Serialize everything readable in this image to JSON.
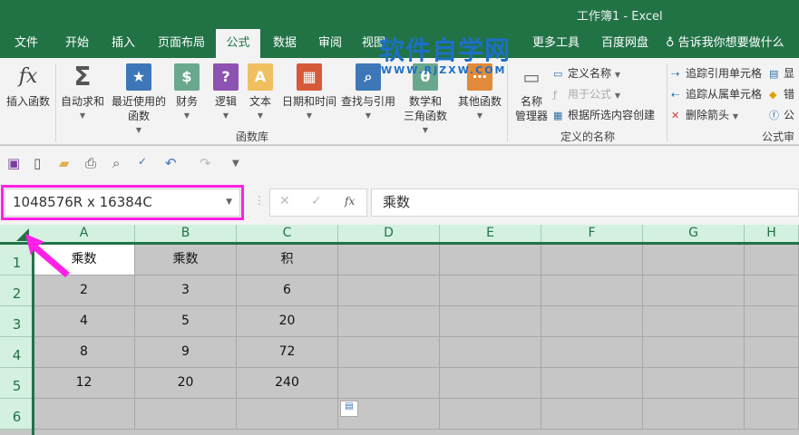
{
  "title": "工作簿1  -  Excel",
  "tabs": [
    "文件",
    "开始",
    "插入",
    "页面布局",
    "公式",
    "数据",
    "审阅",
    "视图",
    "更多工具",
    "百度网盘"
  ],
  "active_tab": "公式",
  "tell_me": "告诉我你想要做什么",
  "watermark": {
    "main": "软件自学网",
    "sub": "WWW.RJZXW.COM"
  },
  "ribbon": {
    "insert_function": "插入函数",
    "library": [
      {
        "line1": "自动求和",
        "line2": "",
        "icon": "sigma-icon",
        "glyph": "Σ",
        "color": "#555555"
      },
      {
        "line1": "最近使用的",
        "line2": "函数",
        "icon": "star-book-icon",
        "glyph": "★",
        "color": "#3d77b8"
      },
      {
        "line1": "财务",
        "line2": "",
        "icon": "coins-book-icon",
        "glyph": "$",
        "color": "#6aa88e"
      },
      {
        "line1": "逻辑",
        "line2": "",
        "icon": "question-book-icon",
        "glyph": "?",
        "color": "#8e52b2"
      },
      {
        "line1": "文本",
        "line2": "",
        "icon": "text-book-icon",
        "glyph": "A",
        "color": "#f0c060"
      },
      {
        "line1": "日期和时间",
        "line2": "",
        "icon": "calendar-book-icon",
        "glyph": "▦",
        "color": "#d65a3a"
      },
      {
        "line1": "查找与引用",
        "line2": "",
        "icon": "search-book-icon",
        "glyph": "⌕",
        "color": "#3d77b8"
      },
      {
        "line1": "数学和",
        "line2": "三角函数",
        "icon": "math-book-icon",
        "glyph": "θ",
        "color": "#6aa88e"
      },
      {
        "line1": "其他函数",
        "line2": "",
        "icon": "more-book-icon",
        "glyph": "⋯",
        "color": "#e08a3a"
      }
    ],
    "library_label": "函数库",
    "name_manager": [
      "名称",
      "管理器"
    ],
    "define_name": "定义名称",
    "use_in_formula": "用于公式",
    "create_from_selection": "根据所选内容创建",
    "names_label": "定义的名称",
    "trace_precedents": "追踪引用单元格",
    "trace_dependents": "追踪从属单元格",
    "remove_arrows": "删除箭头",
    "audit_label": "公式审",
    "audit_partial": [
      "显",
      "错",
      "公"
    ]
  },
  "namebox": "1048576R x 16384C",
  "formula": "乘数",
  "columns": [
    "A",
    "B",
    "C",
    "D",
    "E",
    "F",
    "G",
    "H"
  ],
  "rows": [
    "1",
    "2",
    "3",
    "4",
    "5",
    "6"
  ],
  "cells": [
    [
      "乘数",
      "乘数",
      "积"
    ],
    [
      "2",
      "3",
      "6"
    ],
    [
      "4",
      "5",
      "20"
    ],
    [
      "8",
      "9",
      "72"
    ],
    [
      "12",
      "20",
      "240"
    ],
    [
      "",
      "",
      ""
    ]
  ],
  "colors": {
    "accent": "#217346",
    "highlight": "#ff1fe6"
  }
}
